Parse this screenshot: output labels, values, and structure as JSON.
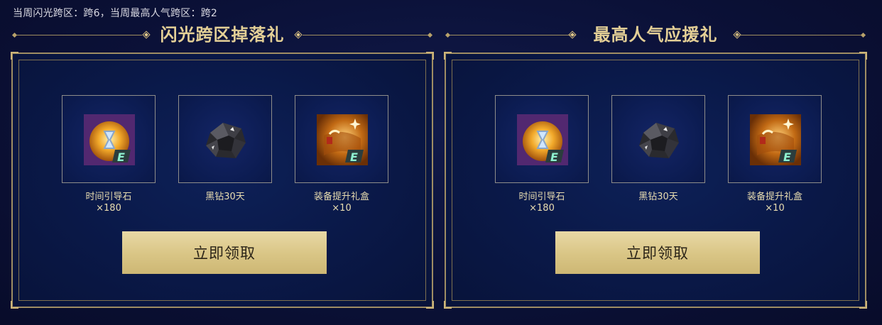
{
  "status_text": "当周闪光跨区：跨6，当周最高人气跨区：跨2",
  "panels": [
    {
      "title": "闪光跨区掉落礼",
      "items": [
        {
          "name": "时间引导石",
          "qty": "×180",
          "icon": "time-guide-stone-icon"
        },
        {
          "name": "黑钻30天",
          "qty": "",
          "icon": "black-diamond-icon"
        },
        {
          "name": "装备提升礼盒",
          "qty": "×10",
          "icon": "equipment-upgrade-box-icon"
        }
      ],
      "button_label": "立即领取"
    },
    {
      "title": "最高人气应援礼",
      "items": [
        {
          "name": "时间引导石",
          "qty": "×180",
          "icon": "time-guide-stone-icon"
        },
        {
          "name": "黑钻30天",
          "qty": "",
          "icon": "black-diamond-icon"
        },
        {
          "name": "装备提升礼盒",
          "qty": "×10",
          "icon": "equipment-upgrade-box-icon"
        }
      ],
      "button_label": "立即领取"
    }
  ],
  "colors": {
    "background": "#0b1138",
    "gold_text": "#e3cf96",
    "frame_border": "#9f8d63",
    "button": "#dbc787"
  }
}
